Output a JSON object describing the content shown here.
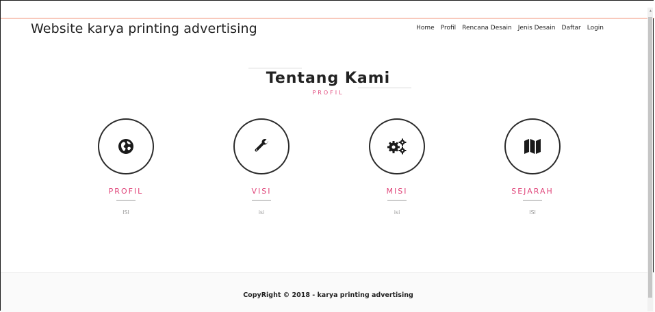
{
  "header": {
    "brand": "Website karya printing advertising",
    "nav": [
      "Home",
      "Profil",
      "Rencana Desain",
      "Jenis Desain",
      "Daftar",
      "Login"
    ]
  },
  "section": {
    "title": "Tentang Kami",
    "subtitle": "PROFIL"
  },
  "features": [
    {
      "title": "PROFIL",
      "text": "ISI",
      "icon": "globe-icon"
    },
    {
      "title": "VISI",
      "text": "isi",
      "icon": "wrench-icon"
    },
    {
      "title": "MISI",
      "text": "isi",
      "icon": "gears-icon"
    },
    {
      "title": "SEJARAH",
      "text": "ISI",
      "icon": "map-icon"
    }
  ],
  "footer": {
    "text": "CopyRight © 2018 - karya printing advertising"
  },
  "colors": {
    "accent": "#e0457a",
    "topbar_line": "#f08a6e",
    "text": "#222222"
  }
}
